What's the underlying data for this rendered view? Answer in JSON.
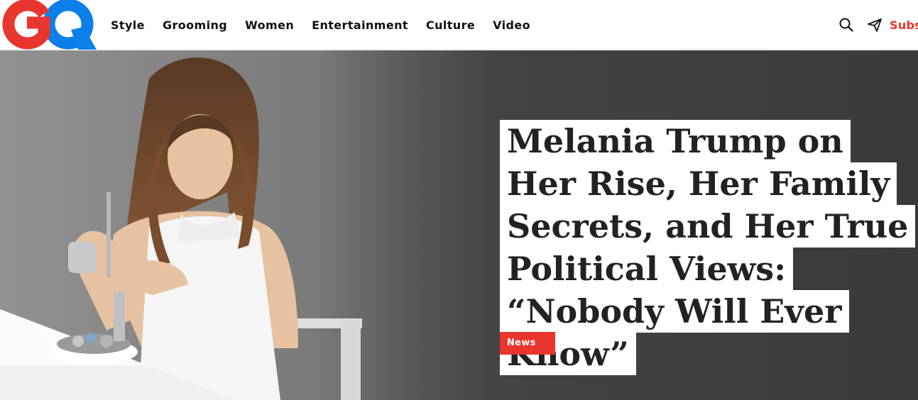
{
  "header": {
    "logo_text": "GQ",
    "nav": [
      {
        "label": "Style"
      },
      {
        "label": "Grooming"
      },
      {
        "label": "Women"
      },
      {
        "label": "Entertainment"
      },
      {
        "label": "Culture"
      },
      {
        "label": "Video"
      }
    ],
    "tools": {
      "search_icon": "search-icon",
      "share_icon": "paper-plane-icon",
      "subscribe_label": "Subs"
    }
  },
  "hero": {
    "headline": "Melania Trump on Her Rise, Her Family Secrets, and Her True Political Views: “Nobody Will Ever Know”",
    "tag": "News"
  },
  "colors": {
    "brand_red": "#e8352e",
    "brand_blue": "#0d7fe8",
    "text_dark": "#111111"
  }
}
